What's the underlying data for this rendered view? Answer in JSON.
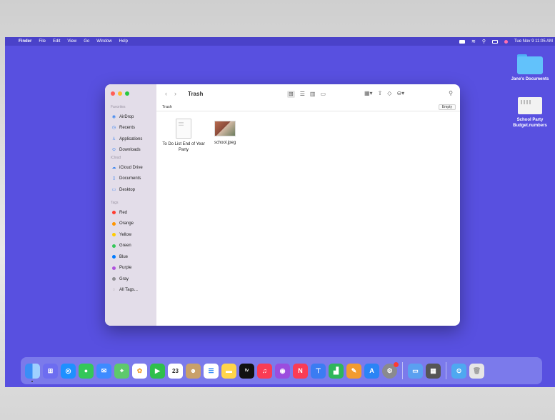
{
  "menubar": {
    "app": "Finder",
    "items": [
      "File",
      "Edit",
      "View",
      "Go",
      "Window",
      "Help"
    ],
    "clock": "Tue Nov 9  11:05 AM"
  },
  "desktop": {
    "items": [
      {
        "label": "Jane's Documents",
        "icon": "folder-icon"
      },
      {
        "label": "School Party Budget.numbers",
        "icon": "document-icon"
      }
    ]
  },
  "finder": {
    "title": "Trash",
    "path": "Trash",
    "empty_label": "Empty",
    "sidebar": {
      "favorites_head": "Favorites",
      "favorites": [
        {
          "label": "AirDrop",
          "icon": "airdrop-icon"
        },
        {
          "label": "Recents",
          "icon": "clock-icon"
        },
        {
          "label": "Applications",
          "icon": "applications-icon"
        },
        {
          "label": "Downloads",
          "icon": "download-icon"
        }
      ],
      "icloud_head": "iCloud",
      "icloud": [
        {
          "label": "iCloud Drive",
          "icon": "cloud-icon"
        },
        {
          "label": "Documents",
          "icon": "document-icon"
        },
        {
          "label": "Desktop",
          "icon": "desktop-icon"
        }
      ],
      "tags_head": "Tags",
      "tags": [
        {
          "label": "Red",
          "color": "#ff3b30"
        },
        {
          "label": "Orange",
          "color": "#ff9500"
        },
        {
          "label": "Yellow",
          "color": "#ffcc00"
        },
        {
          "label": "Green",
          "color": "#34c759"
        },
        {
          "label": "Blue",
          "color": "#007aff"
        },
        {
          "label": "Purple",
          "color": "#af52de"
        },
        {
          "label": "Gray",
          "color": "#8e8e93"
        },
        {
          "label": "All Tags...",
          "color": ""
        }
      ]
    },
    "files": [
      {
        "name": "To Do List End of Year Party",
        "icon": "text-document-icon"
      },
      {
        "name": "school.jpeg",
        "icon": "image-thumbnail-icon"
      }
    ]
  },
  "dock": {
    "calendar_day": "23",
    "apps": [
      {
        "name": "finder-icon",
        "color": "#3a8ef6"
      },
      {
        "name": "launchpad-icon",
        "color": "#6d6df0"
      },
      {
        "name": "safari-icon",
        "color": "#1e90ff"
      },
      {
        "name": "messages-icon",
        "color": "#34c759"
      },
      {
        "name": "mail-icon",
        "color": "#3d8bff"
      },
      {
        "name": "maps-icon",
        "color": "#5ec96b"
      },
      {
        "name": "photos-icon",
        "color": "#f2a33b"
      },
      {
        "name": "facetime-icon",
        "color": "#2fbf4c"
      },
      {
        "name": "calendar-icon",
        "color": "#ffffff"
      },
      {
        "name": "contacts-icon",
        "color": "#c9a06a"
      },
      {
        "name": "reminders-icon",
        "color": "#ffffff"
      },
      {
        "name": "notes-icon",
        "color": "#ffd54a"
      },
      {
        "name": "tv-icon",
        "color": "#111111"
      },
      {
        "name": "music-icon",
        "color": "#fa3c55"
      },
      {
        "name": "podcasts-icon",
        "color": "#9b4dde"
      },
      {
        "name": "news-icon",
        "color": "#fa3c55"
      },
      {
        "name": "keynote-icon",
        "color": "#3b7cf2"
      },
      {
        "name": "numbers-icon",
        "color": "#2fb65a"
      },
      {
        "name": "pages-icon",
        "color": "#f29b30"
      },
      {
        "name": "app-store-icon",
        "color": "#2a84f5"
      },
      {
        "name": "system-preferences-icon",
        "color": "#8a8a8e"
      }
    ],
    "extras": [
      {
        "name": "preview-icon",
        "color": "#5aa0f0"
      },
      {
        "name": "calculator-icon",
        "color": "#555555"
      },
      {
        "name": "downloads-folder-icon",
        "color": "#4fa8f0"
      },
      {
        "name": "trash-icon",
        "color": "#e6e6e6"
      }
    ]
  }
}
